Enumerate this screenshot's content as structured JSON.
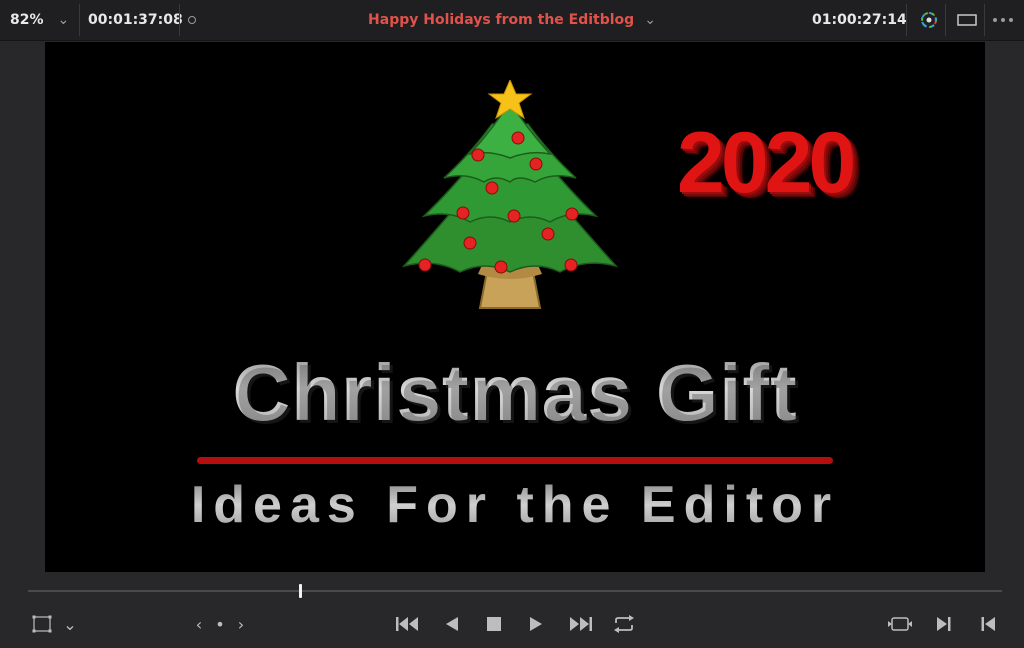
{
  "topbar": {
    "zoom": "82%",
    "source_timecode": "00:01:37:08",
    "timeline_title": "Happy Holidays from the Editblog",
    "record_timecode": "01:00:27:14",
    "chevron": "⌄"
  },
  "icons": {
    "zoom_dropdown": "chevron-down-icon",
    "marker_dot": "circle-dot-icon",
    "title_dropdown": "chevron-down-icon",
    "color_fx": "color-wheel-icon",
    "viewer_mode": "rectangle-icon",
    "more": "more-dots-icon"
  },
  "video_frame": {
    "year": "2020",
    "headline": "Christmas Gift",
    "subline": "Ideas For the Editor"
  },
  "colors": {
    "accent_red": "#e0524a",
    "year_red": "#e11414",
    "underline_red": "#b40e0e",
    "tree_green": "#2f8f2f",
    "star_yellow": "#f6c21a"
  },
  "transport": {
    "playhead_position": 0.28,
    "left_nav": "‹ • ›",
    "buttons": [
      "jump-to-start-icon",
      "play-reverse-icon",
      "stop-icon",
      "play-icon",
      "jump-to-end-icon",
      "loop-icon"
    ],
    "right_buttons": [
      "match-frame-icon",
      "next-edit-icon",
      "prev-edit-icon"
    ]
  }
}
